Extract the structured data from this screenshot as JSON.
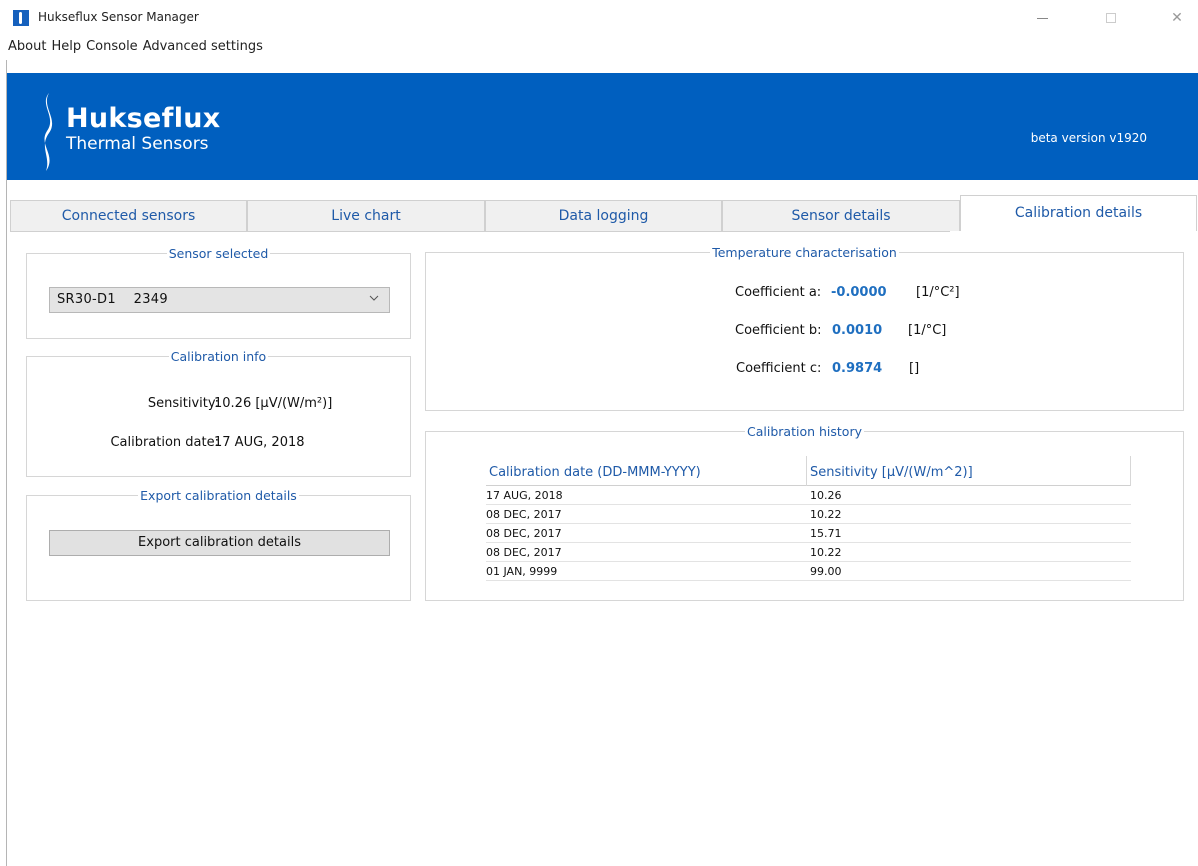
{
  "window": {
    "title": "Hukseflux Sensor Manager",
    "min_glyph": "—",
    "close_glyph": "✕"
  },
  "menu": [
    "About",
    "Help",
    "Console",
    "Advanced settings"
  ],
  "header": {
    "brand": "Hukseflux",
    "subtitle": "Thermal Sensors",
    "version": "beta version v1920",
    "bg_color": "#005fbf"
  },
  "tabs": [
    {
      "label": "Connected sensors",
      "active": false
    },
    {
      "label": "Live chart",
      "active": false
    },
    {
      "label": "Data logging",
      "active": false
    },
    {
      "label": "Sensor details",
      "active": false
    },
    {
      "label": "Calibration details",
      "active": true
    }
  ],
  "sensor_selected": {
    "title": "Sensor selected",
    "value": "SR30-D1    2349"
  },
  "calibration_info": {
    "title": "Calibration info",
    "sensitivity_label": "Sensitivity:",
    "sensitivity_value": "10.26  [µV/(W/m²)]",
    "date_label": "Calibration date:",
    "date_value": "17 AUG, 2018"
  },
  "export": {
    "title": "Export calibration details",
    "button_label": "Export calibration details"
  },
  "temperature": {
    "title": "Temperature characterisation",
    "coefficients": [
      {
        "label": "Coefficient a:",
        "value": "-0.0000",
        "unit": "[1/°C²]"
      },
      {
        "label": "Coefficient b:",
        "value": "0.0010",
        "unit": "[1/°C]"
      },
      {
        "label": "Coefficient c:",
        "value": "0.9874",
        "unit": "[]"
      }
    ]
  },
  "history": {
    "title": "Calibration history",
    "columns": [
      "Calibration date (DD-MMM-YYYY)",
      "Sensitivity [µV/(W/m^2)]"
    ],
    "rows": [
      [
        "17 AUG, 2018",
        "10.26"
      ],
      [
        "08 DEC, 2017",
        "10.22"
      ],
      [
        "08 DEC, 2017",
        "15.71"
      ],
      [
        "08 DEC, 2017",
        "10.22"
      ],
      [
        "01 JAN, 9999",
        "99.00"
      ]
    ]
  }
}
